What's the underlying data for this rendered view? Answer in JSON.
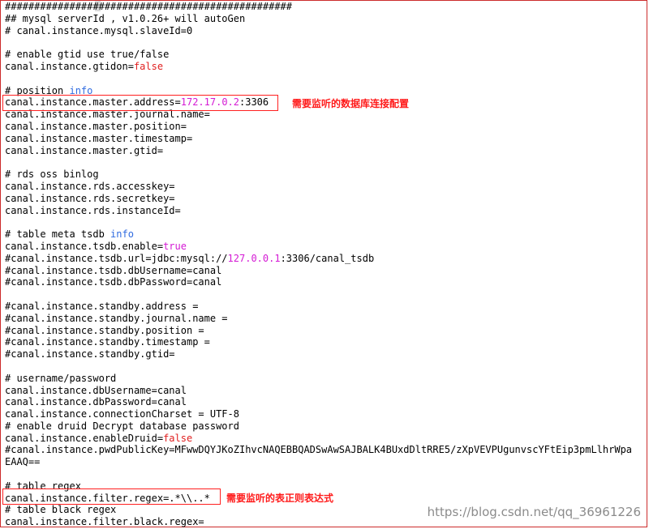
{
  "editor": {
    "lines": [
      {
        "parts": [
          {
            "t": "#################################################"
          }
        ]
      },
      {
        "parts": [
          {
            "t": "## mysql serverId , v1.0.26+ will autoGen"
          }
        ]
      },
      {
        "parts": [
          {
            "t": "# canal.instance.mysql.slaveId=0"
          }
        ]
      },
      {
        "parts": [
          {
            "t": ""
          }
        ]
      },
      {
        "parts": [
          {
            "t": "# enable gtid use true/false"
          }
        ]
      },
      {
        "parts": [
          {
            "t": "canal.instance.gtidon="
          },
          {
            "t": "false",
            "c": "red"
          }
        ]
      },
      {
        "parts": [
          {
            "t": ""
          }
        ]
      },
      {
        "parts": [
          {
            "t": "# position "
          },
          {
            "t": "info",
            "c": "blue"
          }
        ]
      },
      {
        "parts": [
          {
            "t": "canal.instance.master.address="
          },
          {
            "t": "172.17.0.2",
            "c": "magenta"
          },
          {
            "t": ":3306"
          }
        ]
      },
      {
        "parts": [
          {
            "t": "canal.instance.master.journal.name="
          }
        ]
      },
      {
        "parts": [
          {
            "t": "canal.instance.master.position="
          }
        ]
      },
      {
        "parts": [
          {
            "t": "canal.instance.master.timestamp="
          }
        ]
      },
      {
        "parts": [
          {
            "t": "canal.instance.master.gtid="
          }
        ]
      },
      {
        "parts": [
          {
            "t": ""
          }
        ]
      },
      {
        "parts": [
          {
            "t": "# rds oss binlog"
          }
        ]
      },
      {
        "parts": [
          {
            "t": "canal.instance.rds.accesskey="
          }
        ]
      },
      {
        "parts": [
          {
            "t": "canal.instance.rds.secretkey="
          }
        ]
      },
      {
        "parts": [
          {
            "t": "canal.instance.rds.instanceId="
          }
        ]
      },
      {
        "parts": [
          {
            "t": ""
          }
        ]
      },
      {
        "parts": [
          {
            "t": "# table meta tsdb "
          },
          {
            "t": "info",
            "c": "blue"
          }
        ]
      },
      {
        "parts": [
          {
            "t": "canal.instance.tsdb.enable="
          },
          {
            "t": "true",
            "c": "magenta"
          }
        ]
      },
      {
        "parts": [
          {
            "t": "#canal.instance.tsdb.url=jdbc:mysql://"
          },
          {
            "t": "127.0.0.1",
            "c": "magenta"
          },
          {
            "t": ":3306/canal_tsdb"
          }
        ]
      },
      {
        "parts": [
          {
            "t": "#canal.instance.tsdb.dbUsername=canal"
          }
        ]
      },
      {
        "parts": [
          {
            "t": "#canal.instance.tsdb.dbPassword=canal"
          }
        ]
      },
      {
        "parts": [
          {
            "t": ""
          }
        ]
      },
      {
        "parts": [
          {
            "t": "#canal.instance.standby.address ="
          }
        ]
      },
      {
        "parts": [
          {
            "t": "#canal.instance.standby.journal.name ="
          }
        ]
      },
      {
        "parts": [
          {
            "t": "#canal.instance.standby.position ="
          }
        ]
      },
      {
        "parts": [
          {
            "t": "#canal.instance.standby.timestamp ="
          }
        ]
      },
      {
        "parts": [
          {
            "t": "#canal.instance.standby.gtid="
          }
        ]
      },
      {
        "parts": [
          {
            "t": ""
          }
        ]
      },
      {
        "parts": [
          {
            "t": "# username/password"
          }
        ]
      },
      {
        "parts": [
          {
            "t": "canal.instance.dbUsername=canal"
          }
        ]
      },
      {
        "parts": [
          {
            "t": "canal.instance.dbPassword=canal"
          }
        ]
      },
      {
        "parts": [
          {
            "t": "canal.instance.connectionCharset = UTF-8"
          }
        ]
      },
      {
        "parts": [
          {
            "t": "# enable druid Decrypt database password"
          }
        ]
      },
      {
        "parts": [
          {
            "t": "canal.instance.enableDruid="
          },
          {
            "t": "false",
            "c": "red"
          }
        ]
      },
      {
        "parts": [
          {
            "t": "#canal.instance.pwdPublicKey=MFwwDQYJKoZIhvcNAQEBBQADSwAwSAJBALK4BUxdDltRRE5/zXpVEVPUgunvscYFtEip3pmLlhrWpa"
          }
        ]
      },
      {
        "parts": [
          {
            "t": "EAAQ=="
          }
        ]
      },
      {
        "parts": [
          {
            "t": ""
          }
        ]
      },
      {
        "parts": [
          {
            "t": "# table regex"
          }
        ]
      },
      {
        "parts": [
          {
            "t": "canal.instance.filter.regex=.*\\\\..*"
          }
        ]
      },
      {
        "parts": [
          {
            "t": "# table black regex"
          }
        ]
      },
      {
        "parts": [
          {
            "t": "canal.instance.filter.black.regex="
          }
        ]
      }
    ]
  },
  "annotations": {
    "address_note": "需要监听的数据库连接配置",
    "regex_note": "需要监听的表正则表达式"
  },
  "watermark": "https://blog.csdn.net/qq_36961226",
  "colors": {
    "magenta": "#d41ad4",
    "red": "#e02020",
    "blue": "#2f6be0",
    "annotation": "#ff1a1a"
  }
}
